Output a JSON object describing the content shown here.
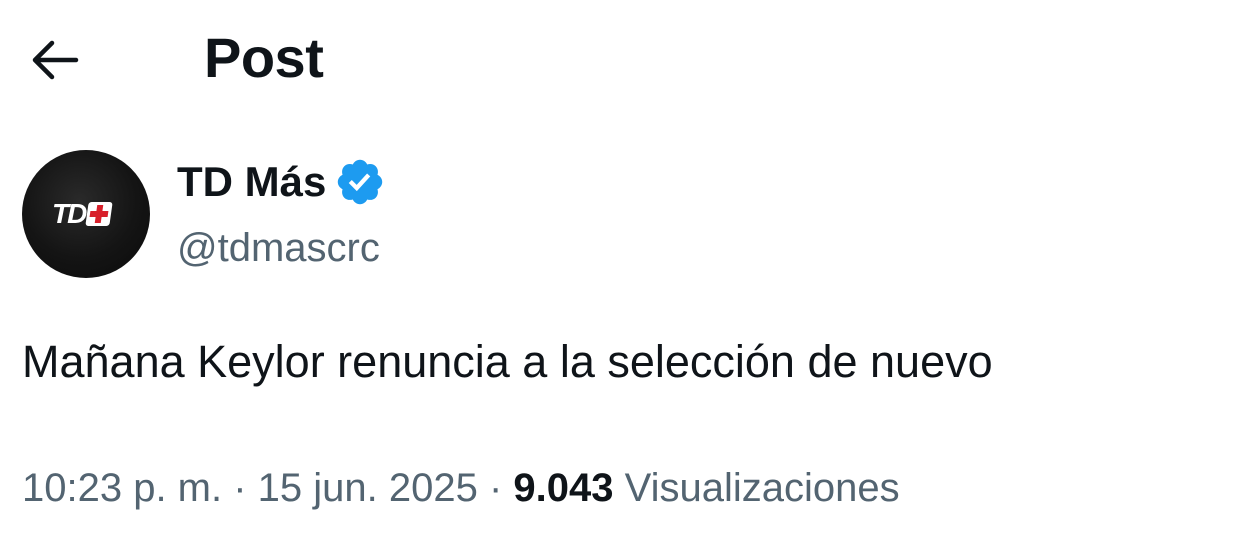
{
  "header": {
    "back_icon": "arrow-left-icon",
    "title": "Post"
  },
  "author": {
    "display_name": "TD Más",
    "handle": "@tdmascrc",
    "verified_icon": "verified-badge-icon",
    "verified_color": "#1d9bf0",
    "avatar_text": "TD"
  },
  "post": {
    "text": "Mañana Keylor renuncia a la selección de nuevo"
  },
  "meta": {
    "time": "10:23 p. m.",
    "separator": " · ",
    "date": "15 jun. 2025",
    "views_count": "9.043",
    "views_label": "Visualizaciones"
  },
  "colors": {
    "text_primary": "#0f1419",
    "text_secondary": "#536471",
    "accent": "#1d9bf0",
    "logo_red": "#d81f2a"
  }
}
